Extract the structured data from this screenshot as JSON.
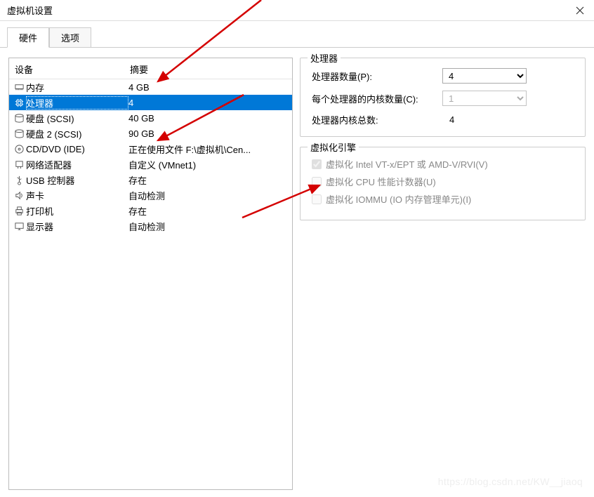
{
  "window": {
    "title": "虚拟机设置"
  },
  "tabs": {
    "hardware": "硬件",
    "options": "选项",
    "active": "hardware"
  },
  "left": {
    "col_device": "设备",
    "col_summary": "摘要",
    "rows": [
      {
        "icon": "memory-icon",
        "name": "内存",
        "summary": "4 GB",
        "selected": false
      },
      {
        "icon": "cpu-icon",
        "name": "处理器",
        "summary": "4",
        "selected": true
      },
      {
        "icon": "disk-icon",
        "name": "硬盘 (SCSI)",
        "summary": "40 GB",
        "selected": false
      },
      {
        "icon": "disk-icon",
        "name": "硬盘 2 (SCSI)",
        "summary": "90 GB",
        "selected": false
      },
      {
        "icon": "cd-icon",
        "name": "CD/DVD (IDE)",
        "summary": "正在使用文件 F:\\虚拟机\\Cen...",
        "selected": false
      },
      {
        "icon": "net-icon",
        "name": "网络适配器",
        "summary": "自定义 (VMnet1)",
        "selected": false
      },
      {
        "icon": "usb-icon",
        "name": "USB 控制器",
        "summary": "存在",
        "selected": false
      },
      {
        "icon": "sound-icon",
        "name": "声卡",
        "summary": "自动检测",
        "selected": false
      },
      {
        "icon": "printer-icon",
        "name": "打印机",
        "summary": "存在",
        "selected": false
      },
      {
        "icon": "display-icon",
        "name": "显示器",
        "summary": "自动检测",
        "selected": false
      }
    ]
  },
  "right": {
    "group_processor": "处理器",
    "proc_count_label": "处理器数量(P):",
    "proc_count_value": "4",
    "cores_label": "每个处理器的内核数量(C):",
    "cores_value": "1",
    "total_label": "处理器内核总数:",
    "total_value": "4",
    "group_virt": "虚拟化引擎",
    "virt_vt": "虚拟化 Intel VT-x/EPT 或 AMD-V/RVI(V)",
    "virt_cpu_perf": "虚拟化 CPU 性能计数器(U)",
    "virt_iommu": "虚拟化 IOMMU (IO 内存管理单元)(I)"
  },
  "watermark": "https://blog.csdn.net/KW__jiaoq"
}
